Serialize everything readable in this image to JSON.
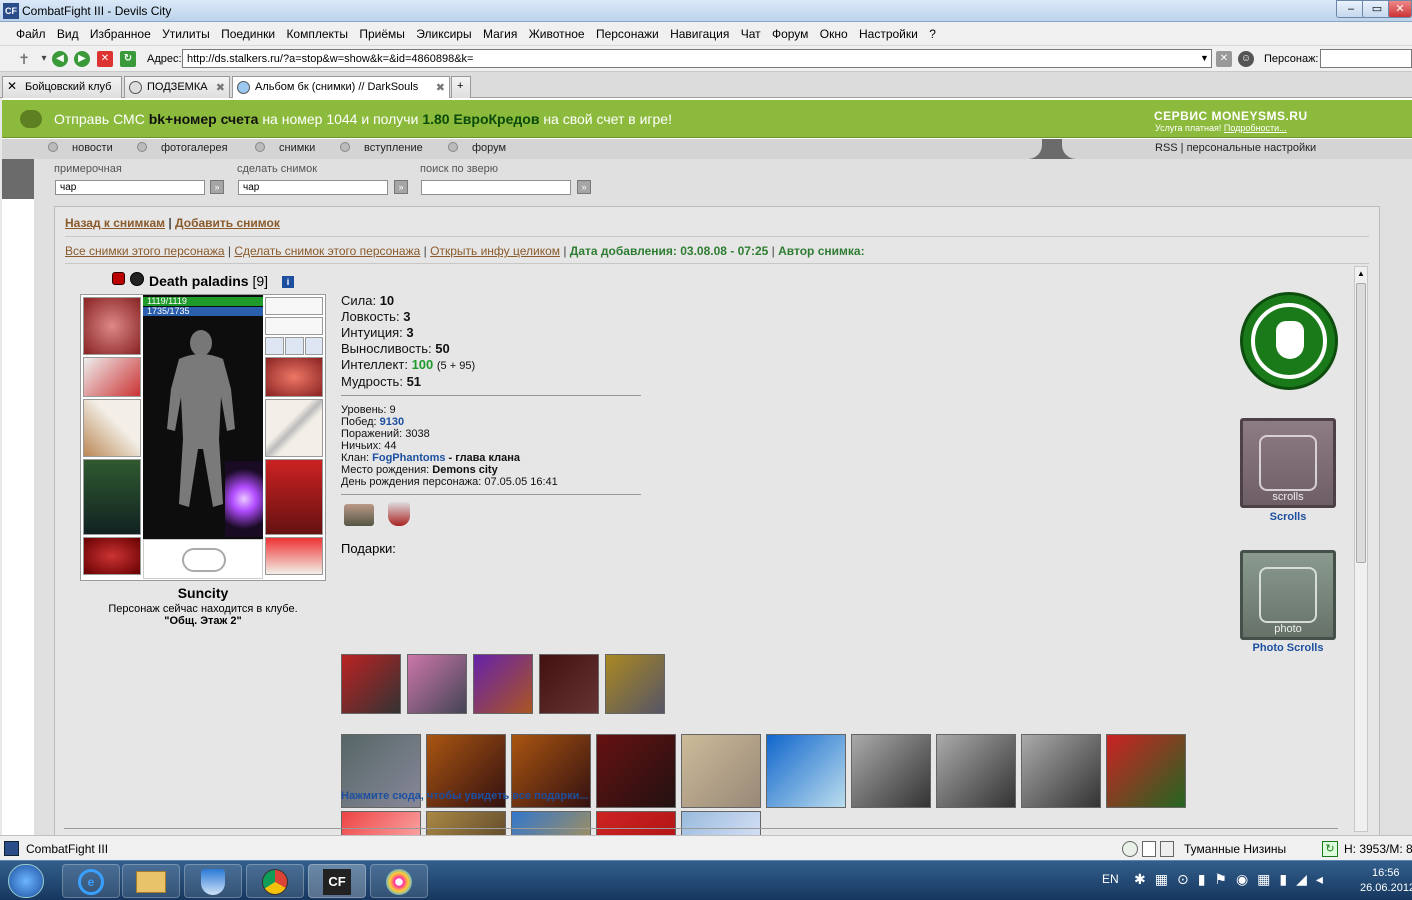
{
  "window": {
    "app_icon": "CF",
    "title": "CombatFight III - Devils City",
    "buttons": [
      "minimize",
      "maximize",
      "close"
    ]
  },
  "menu": [
    "Файл",
    "Вид",
    "Избранное",
    "Утилиты",
    "Поединки",
    "Комплекты",
    "Приёмы",
    "Эликсиры",
    "Магия",
    "Животное",
    "Персонажи",
    "Навигация",
    "Чат",
    "Форум",
    "Окно",
    "Настройки",
    "?"
  ],
  "address": {
    "label": "Адрес:",
    "url": "http://ds.stalkers.ru/?a=stop&w=show&k=&id=4860898&k=",
    "persona_label": "Персонаж:"
  },
  "tabs": [
    {
      "label": "Бойцовский клуб"
    },
    {
      "label": "ПОДЗЕМКА"
    },
    {
      "label": "Альбом бк (снимки) // DarkSouls",
      "active": true
    }
  ],
  "sms": {
    "prefix": "Отправь СМС",
    "code": "bk+номер счета",
    "mid": "на номер 1044 и получи",
    "amount": "1.80 ЕвроКредов",
    "suffix": "на свой счет в игре!",
    "service": "СЕРВИС MONEYSMS.RU",
    "service_note": "Услуга платная!",
    "details": "Подробности..."
  },
  "nav": {
    "items": [
      "новости",
      "фотогалерея",
      "снимки",
      "вступление",
      "форум"
    ],
    "right": "RSS | персональные настройки"
  },
  "search": [
    {
      "label": "примерочная",
      "value": "чар"
    },
    {
      "label": "сделать снимок",
      "value": "чар"
    },
    {
      "label": "поиск по зверю",
      "value": ""
    }
  ],
  "album": {
    "back": "Назад к снимкам",
    "add": "Добавить снимок",
    "all_shots": "Все снимки этого персонажа",
    "make_shot": "Сделать снимок этого персонажа",
    "open_info": "Открыть инфу целиком",
    "date_label": "Дата добавления: 03.08.08 - 07:25",
    "author_label": "Автор снимка:"
  },
  "character": {
    "name": "Death paladins",
    "level_bracket": "[9]",
    "hp": "1119/1119",
    "mana": "1735/1735",
    "city": "Suncity",
    "location_text": "Персонаж сейчас находится в клубе.",
    "location_room": "\"Общ. Этаж 2\""
  },
  "stats": [
    {
      "label": "Сила:",
      "value": "10"
    },
    {
      "label": "Ловкость:",
      "value": "3"
    },
    {
      "label": "Интуиция:",
      "value": "3"
    },
    {
      "label": "Выносливость:",
      "value": "50"
    },
    {
      "label": "Интеллект:",
      "value": "100",
      "extra": "(5 + 95)"
    },
    {
      "label": "Мудрость:",
      "value": "51"
    }
  ],
  "info": {
    "level": "Уровень: 9",
    "wins_label": "Побед:",
    "wins": "9130",
    "losses": "Поражений: 3038",
    "draws": "Ничьих: 44",
    "clan_label": "Клан:",
    "clan": "FogPhantoms",
    "clan_role": "- глава клана",
    "birth_label": "Место рождения:",
    "birth": "Demons city",
    "birthday": "День рождения персонажа: 07.05.05 16:41"
  },
  "gifts_label": "Подарки:",
  "gifts_link": "Нажмите сюда, чтобы увидеть все подарки...",
  "side": {
    "scrolls": "Scrolls",
    "photo_scrolls": "Photo Scrolls",
    "banner_text_1": "scrolls",
    "banner_text_2": "photo"
  },
  "statusbar": {
    "left": "CombatFight III",
    "location": "Туманные Низины",
    "hm": "H: 3953/M: 8"
  },
  "taskbar": {
    "lang": "EN",
    "time": "16:56",
    "date": "26.06.2012"
  },
  "colors": {
    "sms_green": "#8cba3c",
    "link_brown": "#8a5a2a",
    "hp_green": "#1e9a2a",
    "mana_blue": "#2a5fae"
  }
}
